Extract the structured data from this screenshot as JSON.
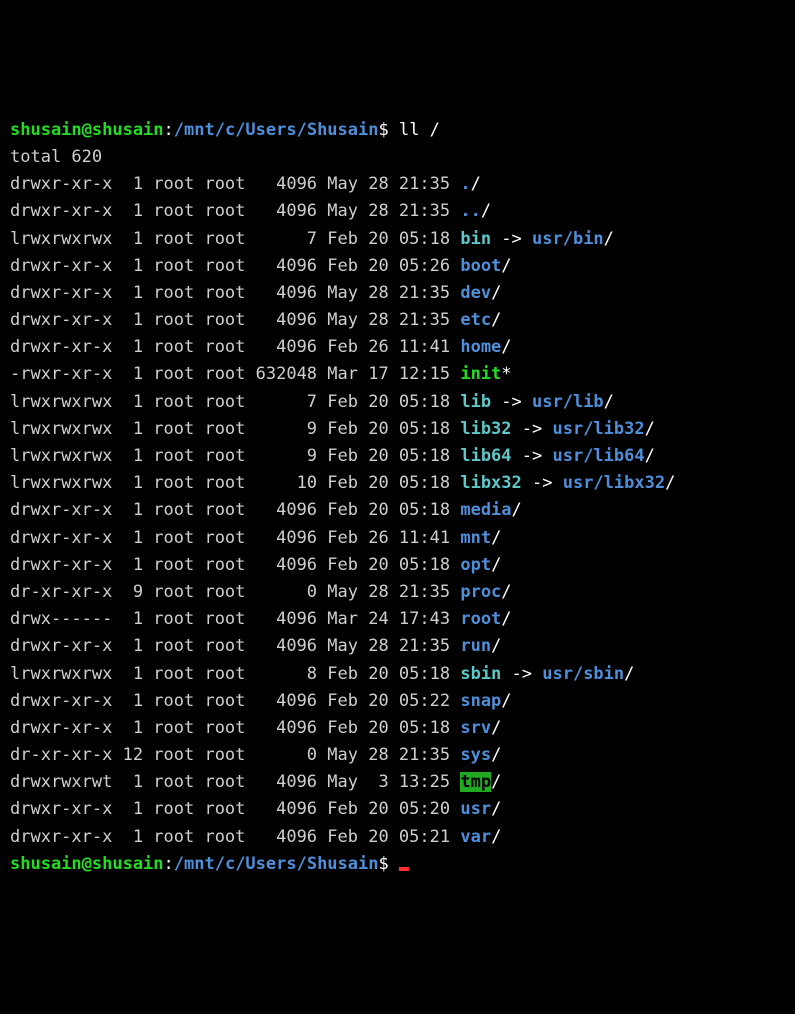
{
  "prompt1": {
    "user": "shusain@shusain",
    "colon": ":",
    "path": "/mnt/c/Users/Shusain",
    "dollar": "$ ",
    "command": "ll /"
  },
  "total_line": "total 620",
  "rows": [
    {
      "cols": "drwxr-xr-x  1 root root   4096 May 28 21:35 ",
      "name": ".",
      "style": "dir",
      "suffix": "/"
    },
    {
      "cols": "drwxr-xr-x  1 root root   4096 May 28 21:35 ",
      "name": "..",
      "style": "dir",
      "suffix": "/"
    },
    {
      "cols": "lrwxrwxrwx  1 root root      7 Feb 20 05:18 ",
      "name": "bin",
      "style": "link",
      "arrow": " -> ",
      "target": "usr/bin",
      "target_suffix": "/"
    },
    {
      "cols": "drwxr-xr-x  1 root root   4096 Feb 20 05:26 ",
      "name": "boot",
      "style": "dir",
      "suffix": "/"
    },
    {
      "cols": "drwxr-xr-x  1 root root   4096 May 28 21:35 ",
      "name": "dev",
      "style": "dir",
      "suffix": "/"
    },
    {
      "cols": "drwxr-xr-x  1 root root   4096 May 28 21:35 ",
      "name": "etc",
      "style": "dir",
      "suffix": "/"
    },
    {
      "cols": "drwxr-xr-x  1 root root   4096 Feb 26 11:41 ",
      "name": "home",
      "style": "dir",
      "suffix": "/"
    },
    {
      "cols": "-rwxr-xr-x  1 root root 632048 Mar 17 12:15 ",
      "name": "init",
      "style": "exec",
      "star": "*"
    },
    {
      "cols": "lrwxrwxrwx  1 root root      7 Feb 20 05:18 ",
      "name": "lib",
      "style": "link",
      "arrow": " -> ",
      "target": "usr/lib",
      "target_suffix": "/"
    },
    {
      "cols": "lrwxrwxrwx  1 root root      9 Feb 20 05:18 ",
      "name": "lib32",
      "style": "link",
      "arrow": " -> ",
      "target": "usr/lib32",
      "target_suffix": "/"
    },
    {
      "cols": "lrwxrwxrwx  1 root root      9 Feb 20 05:18 ",
      "name": "lib64",
      "style": "link",
      "arrow": " -> ",
      "target": "usr/lib64",
      "target_suffix": "/"
    },
    {
      "cols": "lrwxrwxrwx  1 root root     10 Feb 20 05:18 ",
      "name": "libx32",
      "style": "link",
      "arrow": " -> ",
      "target": "usr/libx32",
      "target_suffix": "/"
    },
    {
      "cols": "drwxr-xr-x  1 root root   4096 Feb 20 05:18 ",
      "name": "media",
      "style": "dir",
      "suffix": "/"
    },
    {
      "cols": "drwxr-xr-x  1 root root   4096 Feb 26 11:41 ",
      "name": "mnt",
      "style": "dir",
      "suffix": "/"
    },
    {
      "cols": "drwxr-xr-x  1 root root   4096 Feb 20 05:18 ",
      "name": "opt",
      "style": "dir",
      "suffix": "/"
    },
    {
      "cols": "dr-xr-xr-x  9 root root      0 May 28 21:35 ",
      "name": "proc",
      "style": "dir",
      "suffix": "/"
    },
    {
      "cols": "drwx------  1 root root   4096 Mar 24 17:43 ",
      "name": "root",
      "style": "dir",
      "suffix": "/"
    },
    {
      "cols": "drwxr-xr-x  1 root root   4096 May 28 21:35 ",
      "name": "run",
      "style": "dir",
      "suffix": "/"
    },
    {
      "cols": "lrwxrwxrwx  1 root root      8 Feb 20 05:18 ",
      "name": "sbin",
      "style": "link",
      "arrow": " -> ",
      "target": "usr/sbin",
      "target_suffix": "/"
    },
    {
      "cols": "drwxr-xr-x  1 root root   4096 Feb 20 05:22 ",
      "name": "snap",
      "style": "dir",
      "suffix": "/"
    },
    {
      "cols": "drwxr-xr-x  1 root root   4096 Feb 20 05:18 ",
      "name": "srv",
      "style": "dir",
      "suffix": "/"
    },
    {
      "cols": "dr-xr-xr-x 12 root root      0 May 28 21:35 ",
      "name": "sys",
      "style": "dir",
      "suffix": "/"
    },
    {
      "cols": "drwxrwxrwt  1 root root   4096 May  3 13:25 ",
      "name": "tmp",
      "style": "sticky",
      "suffix": "/"
    },
    {
      "cols": "drwxr-xr-x  1 root root   4096 Feb 20 05:20 ",
      "name": "usr",
      "style": "dir",
      "suffix": "/"
    },
    {
      "cols": "drwxr-xr-x  1 root root   4096 Feb 20 05:21 ",
      "name": "var",
      "style": "dir",
      "suffix": "/"
    }
  ],
  "prompt2": {
    "user": "shusain@shusain",
    "colon": ":",
    "path": "/mnt/c/Users/Shusain",
    "dollar": "$ "
  }
}
